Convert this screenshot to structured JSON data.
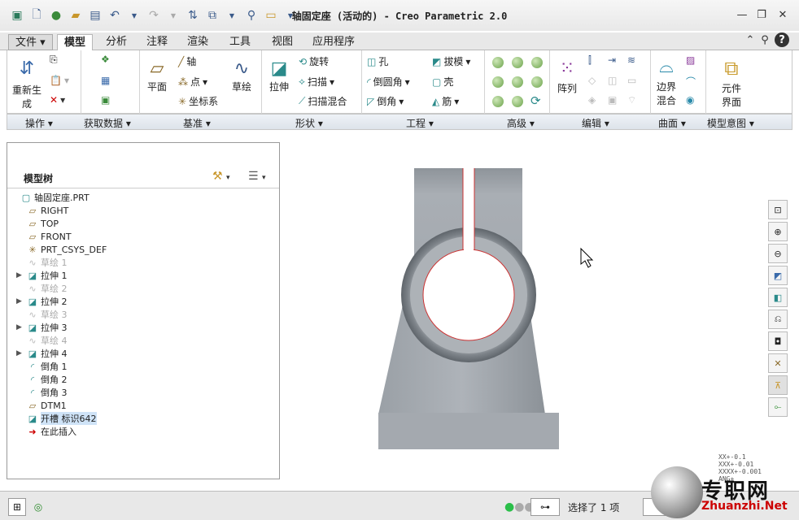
{
  "window": {
    "title": "轴固定座 (活动的) - Creo Parametric 2.0"
  },
  "menu_tabs": [
    "文件",
    "模型",
    "分析",
    "注释",
    "渲染",
    "工具",
    "视图",
    "应用程序"
  ],
  "ribbon": {
    "operations": {
      "regenerate": "重新生",
      "regenerate2": "成",
      "group": "操作"
    },
    "get_data": {
      "group": "获取数据"
    },
    "datum": {
      "plane": "平面",
      "axis": "轴",
      "point": "点",
      "csys": "坐标系",
      "sketch": "草绘",
      "group": "基准"
    },
    "shapes": {
      "extrude": "拉伸",
      "revolve": "旋转",
      "sweep": "扫描",
      "swept_blend": "扫描混合",
      "group": "形状"
    },
    "engineering": {
      "hole": "孔",
      "round": "倒圆角",
      "chamfer": "倒角",
      "draft": "拔模",
      "shell": "壳",
      "rib": "筋",
      "group": "工程"
    },
    "advanced": {
      "group": "高级"
    },
    "editing": {
      "pattern": "阵列",
      "group": "编辑"
    },
    "surfaces": {
      "boundary": "边界",
      "boundary2": "混合",
      "group": "曲面"
    },
    "model_intent": {
      "component": "元件",
      "component2": "界面",
      "group": "模型意图"
    }
  },
  "model_tree": {
    "header": "模型树",
    "items": [
      {
        "label": "轴固定座.PRT",
        "type": "part"
      },
      {
        "label": "RIGHT",
        "type": "datum"
      },
      {
        "label": "TOP",
        "type": "datum"
      },
      {
        "label": "FRONT",
        "type": "datum"
      },
      {
        "label": "PRT_CSYS_DEF",
        "type": "csys"
      },
      {
        "label": "草绘 1",
        "type": "sketch"
      },
      {
        "label": "拉伸 1",
        "type": "extrude"
      },
      {
        "label": "草绘 2",
        "type": "sketch"
      },
      {
        "label": "拉伸 2",
        "type": "extrude"
      },
      {
        "label": "草绘 3",
        "type": "sketch"
      },
      {
        "label": "拉伸 3",
        "type": "extrude"
      },
      {
        "label": "草绘 4",
        "type": "sketch"
      },
      {
        "label": "拉伸 4",
        "type": "extrude"
      },
      {
        "label": "倒角 1",
        "type": "round"
      },
      {
        "label": "倒角 2",
        "type": "round"
      },
      {
        "label": "倒角 3",
        "type": "round"
      },
      {
        "label": "DTM1",
        "type": "datum"
      },
      {
        "label": "开槽 标识642",
        "type": "cut"
      },
      {
        "label": "在此插入",
        "type": "insert"
      }
    ]
  },
  "coords_overlay": [
    "XX+-0.1",
    "XXX+-0.01",
    "XXXX+-0.001",
    "ANG+"
  ],
  "status": {
    "selection": "选择了 1 项"
  },
  "watermark": {
    "text": "专职网",
    "url": "Zhuanzhi.Net"
  }
}
